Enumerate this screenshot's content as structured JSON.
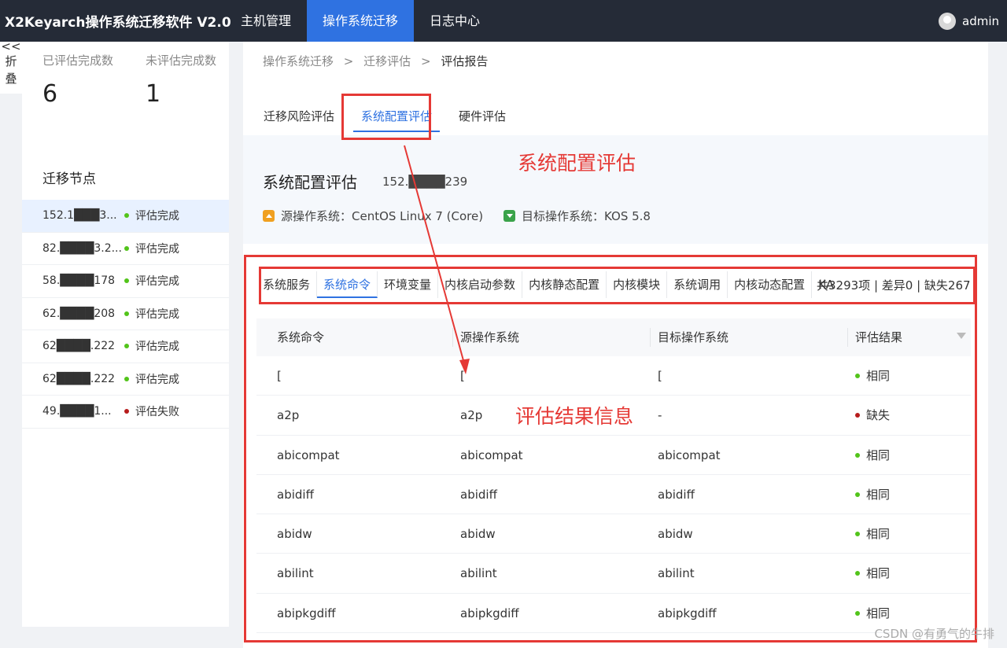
{
  "app_title": "X2Keyarch操作系统迁移软件 V2.0",
  "nav": [
    {
      "label": "主机管理",
      "active": false
    },
    {
      "label": "操作系统迁移",
      "active": true
    },
    {
      "label": "日志中心",
      "active": false
    }
  ],
  "user": {
    "name": "admin"
  },
  "collapse": {
    "arrows": "<<",
    "line1": "折",
    "line2": "叠"
  },
  "stats": {
    "done_label": "已评估完成数",
    "done_value": "6",
    "pending_label": "未评估完成数",
    "pending_value": "1"
  },
  "nodes_title": "迁移节点",
  "nodes": [
    {
      "ip": "152.1███3...",
      "status": "评估完成",
      "color": "#52c41a",
      "active": true
    },
    {
      "ip": "82.████3.2...",
      "status": "评估完成",
      "color": "#52c41a",
      "active": false
    },
    {
      "ip": "58.████178",
      "status": "评估完成",
      "color": "#52c41a",
      "active": false
    },
    {
      "ip": "62.████208",
      "status": "评估完成",
      "color": "#52c41a",
      "active": false
    },
    {
      "ip": "62████.222",
      "status": "评估完成",
      "color": "#52c41a",
      "active": false
    },
    {
      "ip": "62████.222",
      "status": "评估完成",
      "color": "#52c41a",
      "active": false
    },
    {
      "ip": "49.████1...",
      "status": "评估失败",
      "color": "#b71c1c",
      "active": false
    }
  ],
  "breadcrumb": [
    "操作系统迁移",
    ">",
    "迁移评估",
    ">",
    "评估报告"
  ],
  "tabs": [
    {
      "label": "迁移风险评估",
      "active": false
    },
    {
      "label": "系统配置评估",
      "active": true
    },
    {
      "label": "硬件评估",
      "active": false
    }
  ],
  "info": {
    "title": "系统配置评估",
    "ip": "152.████239",
    "source_os": "源操作系统：CentOS Linux 7 (Core)",
    "target_os": "目标操作系统：KOS 5.8"
  },
  "annotations": {
    "top": "系统配置评估",
    "middle": "评估结果信息"
  },
  "subtabs": [
    {
      "label": "系统服务",
      "active": false
    },
    {
      "label": "系统命令",
      "active": true
    },
    {
      "label": "环境变量",
      "active": false
    },
    {
      "label": "内核启动参数",
      "active": false
    },
    {
      "label": "内核静态配置",
      "active": false
    },
    {
      "label": "内核模块",
      "active": false
    },
    {
      "label": "系统调用",
      "active": false
    },
    {
      "label": "内核动态配置",
      "active": false
    },
    {
      "label": "KA",
      "active": false
    }
  ],
  "summary": "共3293项 | 差异0 | 缺失267",
  "table": {
    "headers": [
      "系统命令",
      "源操作系统",
      "目标操作系统",
      "评估结果"
    ],
    "rows": [
      {
        "cmd": "[",
        "src": "[",
        "tgt": "[",
        "result": "相同",
        "color": "#52c41a"
      },
      {
        "cmd": "a2p",
        "src": "a2p",
        "tgt": "-",
        "result": "缺失",
        "color": "#b71c1c"
      },
      {
        "cmd": "abicompat",
        "src": "abicompat",
        "tgt": "abicompat",
        "result": "相同",
        "color": "#52c41a"
      },
      {
        "cmd": "abidiff",
        "src": "abidiff",
        "tgt": "abidiff",
        "result": "相同",
        "color": "#52c41a"
      },
      {
        "cmd": "abidw",
        "src": "abidw",
        "tgt": "abidw",
        "result": "相同",
        "color": "#52c41a"
      },
      {
        "cmd": "abilint",
        "src": "abilint",
        "tgt": "abilint",
        "result": "相同",
        "color": "#52c41a"
      },
      {
        "cmd": "abipkgdiff",
        "src": "abipkgdiff",
        "tgt": "abipkgdiff",
        "result": "相同",
        "color": "#52c41a"
      }
    ]
  },
  "watermark": "CSDN @有勇气的牛排"
}
